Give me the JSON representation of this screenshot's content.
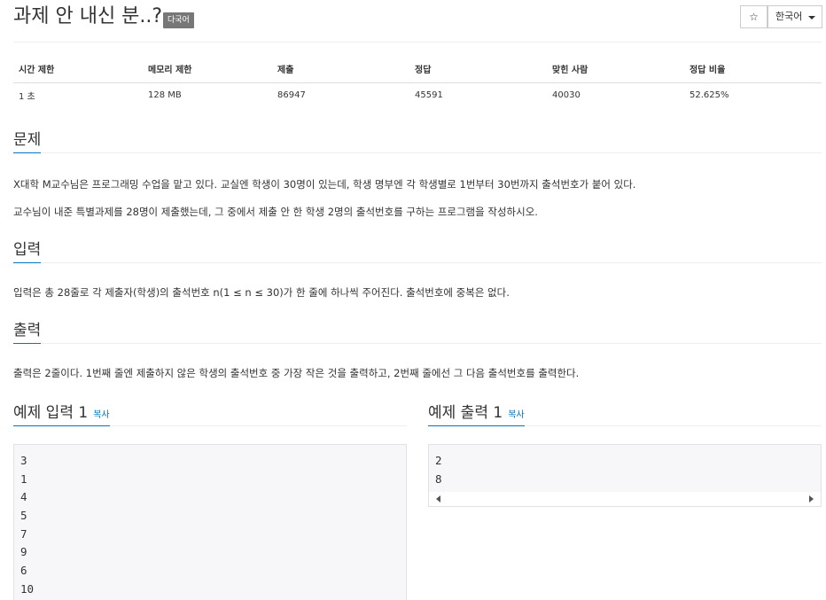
{
  "header": {
    "title": "과제 안 내신 분..?",
    "badge": "다국어",
    "star_label": "☆",
    "lang_label": "한국어"
  },
  "info": {
    "columns": [
      "시간 제한",
      "메모리 제한",
      "제출",
      "정답",
      "맞힌 사람",
      "정답 비율"
    ],
    "values": [
      "1 초",
      "128 MB",
      "86947",
      "45591",
      "40030",
      "52.625%"
    ]
  },
  "problem": {
    "heading": "문제",
    "p1": "X대학 M교수님은 프로그래밍 수업을 맡고 있다. 교실엔 학생이 30명이 있는데, 학생 명부엔 각 학생별로 1번부터 30번까지 출석번호가 붙어 있다.",
    "p2": "교수님이 내준 특별과제를 28명이 제출했는데, 그 중에서 제출 안 한 학생 2명의 출석번호를 구하는 프로그램을 작성하시오."
  },
  "input": {
    "heading": "입력",
    "p1": "입력은 총 28줄로 각 제출자(학생)의 출석번호 n(1 ≤ n ≤ 30)가 한 줄에 하나씩 주어진다. 출석번호에 중복은 없다."
  },
  "output": {
    "heading": "출력",
    "p1": "출력은 2줄이다. 1번째 줄엔 제출하지 않은 학생의 출석번호 중 가장 작은 것을 출력하고, 2번째 줄에선 그 다음 출석번호를 출력한다."
  },
  "sample_input": {
    "heading": "예제 입력 1",
    "copy": "복사",
    "lines": [
      "3",
      "1",
      "4",
      "5",
      "7",
      "9",
      "6",
      "10"
    ]
  },
  "sample_output": {
    "heading": "예제 출력 1",
    "copy": "복사",
    "lines": [
      "2",
      "8"
    ]
  }
}
